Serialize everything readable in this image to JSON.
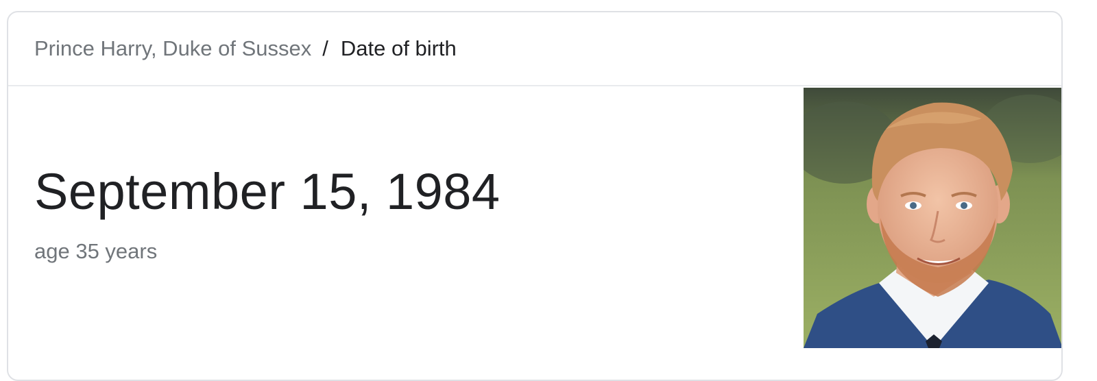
{
  "breadcrumb": {
    "entity": "Prince Harry, Duke of Sussex",
    "separator": "/",
    "attribute": "Date of birth"
  },
  "answer": {
    "value": "September 15, 1984",
    "subtitle": "age 35 years"
  },
  "photo": {
    "icon": "portrait-photo",
    "background_color": "#8aa05a",
    "suit_color": "#2f4f86"
  }
}
